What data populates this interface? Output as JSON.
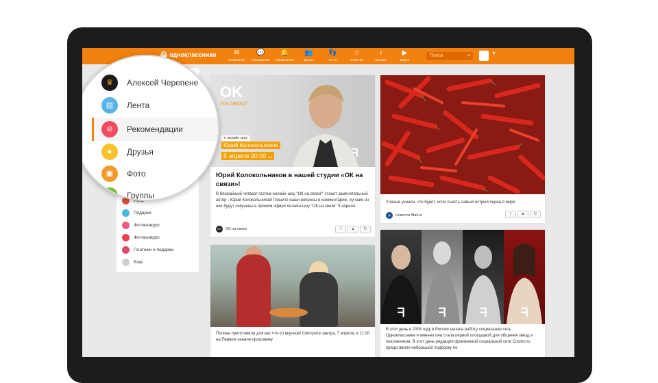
{
  "colors": {
    "brand": "#f2810d",
    "accent": "#f6a000",
    "bezel": "#1c1c1c"
  },
  "app": {
    "name": "одноклассники"
  },
  "nav": [
    {
      "label": "Сообщения",
      "icon": "envelope-icon",
      "glyph": "✉"
    },
    {
      "label": "Обсуждения",
      "icon": "chat-icon",
      "glyph": "💬"
    },
    {
      "label": "Оповещения",
      "icon": "bell-icon",
      "glyph": "🔔"
    },
    {
      "label": "Друзья",
      "icon": "friends-icon",
      "glyph": "👥"
    },
    {
      "label": "Гости",
      "icon": "footprints-icon",
      "glyph": "👣"
    },
    {
      "label": "События",
      "icon": "events-icon",
      "glyph": "☆"
    },
    {
      "label": "Музыка",
      "icon": "music-icon",
      "glyph": "♪"
    },
    {
      "label": "Видео",
      "icon": "video-icon",
      "glyph": "▶"
    }
  ],
  "search": {
    "placeholder": "Поиск"
  },
  "left_menu": [
    {
      "label": "Игры",
      "color": "#e5533b"
    },
    {
      "label": "Подарки",
      "color": "#49b5e0"
    },
    {
      "label": "Фотоконкурс",
      "color": "#ef5c80"
    },
    {
      "label": "Фотоконкурс",
      "color": "#e8414f"
    },
    {
      "label": "Платежи и подарки",
      "color": "#dc4c6a"
    },
    {
      "label": "Ещё",
      "color": "#cfcfcf"
    }
  ],
  "magnifier": {
    "items": [
      {
        "label": "Алексей Черепене",
        "icon": "crown-icon",
        "color": "#1b1b1b",
        "glyph": "♛"
      },
      {
        "label": "Лента",
        "icon": "feed-icon",
        "color": "#59b3e8",
        "glyph": "▤"
      },
      {
        "label": "Рекомендации",
        "icon": "compass-icon",
        "color": "#ef4c5e",
        "glyph": "⊘"
      },
      {
        "label": "Друзья",
        "icon": "friends-icon",
        "color": "#f6c12a",
        "glyph": "●"
      },
      {
        "label": "Фото",
        "icon": "photo-icon",
        "color": "#f49a2b",
        "glyph": "▣"
      },
      {
        "label": "Группы",
        "icon": "groups-icon",
        "color": "#7cbd3a",
        "glyph": "●"
      }
    ]
  },
  "posts": {
    "p1": {
      "logo": "OK",
      "subtitle": "На связи!",
      "show": "онлайн-шоу",
      "guest": "Юрий Колокольников",
      "date": "5 апреля 20:00",
      "date_suffix": "мск",
      "title": "Юрий Колокольников в нашей студии «ОК на связи»!",
      "text": "В ближайший четверг гостем онлайн-шоу \"ОК на связи!\" станет замечательный актёр - Юрий Колокольников! Пишите ваши вопросы в комментарии, лучшие из них будут озвучены в прямом эфире онлайн-шоу \"ОК на связи\" 5 апреля.",
      "source": "ОК на связи",
      "source_icon": "OK"
    },
    "p2": {
      "text": "Полина приготовила для вас что-то вкусное! Смотрите завтра, 7 апреля, в 11:20 на Первом канале программу"
    },
    "p3": {
      "text": "Ученые узнали, что будет, если съесть самый острый перец в мире",
      "source": "Новости Mail.ru",
      "source_icon": "@"
    },
    "p4": {
      "text": "В этот день в 2006 году в России начала работу социальная сеть Одноклассники и именно она стала первой площадкой для общения звезд и поклонников. В этот день редакция франкеевой социальной сети Cosmo.ru представили небольшой подборку по"
    }
  }
}
